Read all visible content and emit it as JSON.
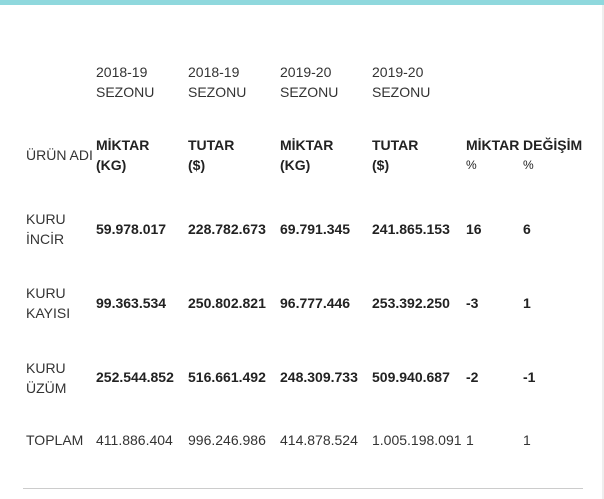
{
  "table": {
    "season_headers": [
      {
        "line1": "2018-19",
        "line2": "SEZONU"
      },
      {
        "line1": "2018-19",
        "line2": "SEZONU"
      },
      {
        "line1": "2019-20",
        "line2": "SEZONU"
      },
      {
        "line1": "2019-20",
        "line2": "SEZONU"
      }
    ],
    "column_headers": {
      "product": "ÜRÜN ADI",
      "qty1": {
        "line1": "MİKTAR",
        "line2": "(KG)"
      },
      "amt1": {
        "line1": "TUTAR",
        "line2": "($)"
      },
      "qty2": {
        "line1": "MİKTAR",
        "line2": "(KG)"
      },
      "amt2": {
        "line1": "TUTAR",
        "line2": "($)"
      },
      "qty_change": {
        "line1": "MİKTAR",
        "line2": "%"
      },
      "change": {
        "line1": "DEĞİŞİM",
        "line2": "%"
      }
    },
    "rows": [
      {
        "name1": "KURU",
        "name2": "İNCİR",
        "qty1": "59.978.017",
        "amt1": "228.782.673",
        "qty2": "69.791.345",
        "amt2": "241.865.153",
        "qty_change": "16",
        "change": "6"
      },
      {
        "name1": "KURU",
        "name2": "KAYISI",
        "qty1": "99.363.534",
        "amt1": "250.802.821",
        "qty2": "96.777.446",
        "amt2": "253.392.250",
        "qty_change": "-3",
        "change": "1"
      },
      {
        "name1": "KURU",
        "name2": "ÜZÜM",
        "qty1": "252.544.852",
        "amt1": "516.661.492",
        "qty2": "248.309.733",
        "amt2": "509.940.687",
        "qty_change": "-2",
        "change": "-1"
      }
    ],
    "total": {
      "name": "TOPLAM",
      "qty1": "411.886.404",
      "amt1": "996.246.986",
      "qty2": "414.878.524",
      "amt2": "1.005.198.091",
      "qty_change": "1",
      "change": "1"
    }
  }
}
